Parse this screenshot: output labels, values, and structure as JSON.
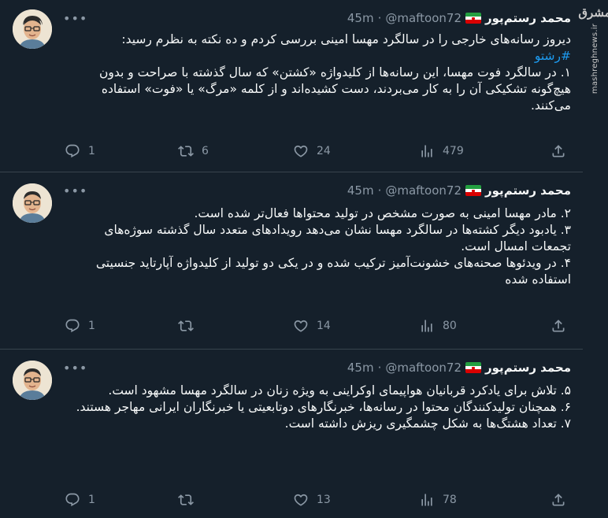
{
  "watermark": {
    "logo": "مشرق",
    "site": "mashreghnews.ir"
  },
  "icons": {
    "reply": "reply-icon",
    "retweet": "retweet-icon",
    "like": "heart-icon",
    "views": "views-icon",
    "share": "share-icon",
    "more": "more-icon"
  },
  "colors": {
    "background": "#15202b",
    "text": "#f7f9f9",
    "muted": "#8b98a5",
    "link": "#1d9bf0",
    "divider": "#38444d"
  },
  "tweets": [
    {
      "author": {
        "name": "محمد رستم‌پور",
        "handle": "@maftoon72",
        "separator": "·",
        "time": "45m"
      },
      "lines": [
        "دیروز رسانه‌های خارجی را در سالگرد مهسا امینی بررسی کردم و ده نکته به نظرم رسید:",
        "#رشتو",
        "۱. در سالگرد فوت مهسا، این رسانه‌ها از کلیدواژه «کشتن» که سال گذشته با صراحت و بدون هیچ‌گونه تشکیکی آن را به کار می‌بردند، دست کشیده‌اند و از کلمه «مرگ» یا «فوت» استفاده می‌کنند."
      ],
      "stats": {
        "replies": "1",
        "retweets": "6",
        "likes": "24",
        "views": "479"
      }
    },
    {
      "author": {
        "name": "محمد رستم‌پور",
        "handle": "@maftoon72",
        "separator": "·",
        "time": "45m"
      },
      "lines": [
        "۲. مادر مهسا امینی به صورت مشخص در تولید محتواها فعال‌تر شده است.",
        "۳. یادبود دیگر کشته‌ها در سالگرد مهسا نشان می‌دهد رویدادهای متعدد سال گذشته سوژه‌های تجمعات امسال است.",
        "۴. در ویدئوها صحنه‌های خشونت‌آمیز ترکیب شده و در یکی دو تولید از کلیدواژه آپارتاید جنسیتی استفاده شده"
      ],
      "stats": {
        "replies": "1",
        "retweets": "",
        "likes": "14",
        "views": "80"
      }
    },
    {
      "author": {
        "name": "محمد رستم‌پور",
        "handle": "@maftoon72",
        "separator": "·",
        "time": "45m"
      },
      "lines": [
        "۵. تلاش برای یادکرد قربانیان هواپیمای اوکراینی به ویژه زنان در سالگرد مهسا مشهود است.",
        "۶. همچنان تولیدکنندگان محتوا در رسانه‌ها، خبرنگارهای دوتابعیتی یا خبرنگاران ایرانی مهاجر هستند.",
        "۷. تعداد هشتگ‌ها به شکل چشمگیری ریزش داشته است."
      ],
      "stats": {
        "replies": "1",
        "retweets": "",
        "likes": "13",
        "views": "78"
      }
    }
  ]
}
